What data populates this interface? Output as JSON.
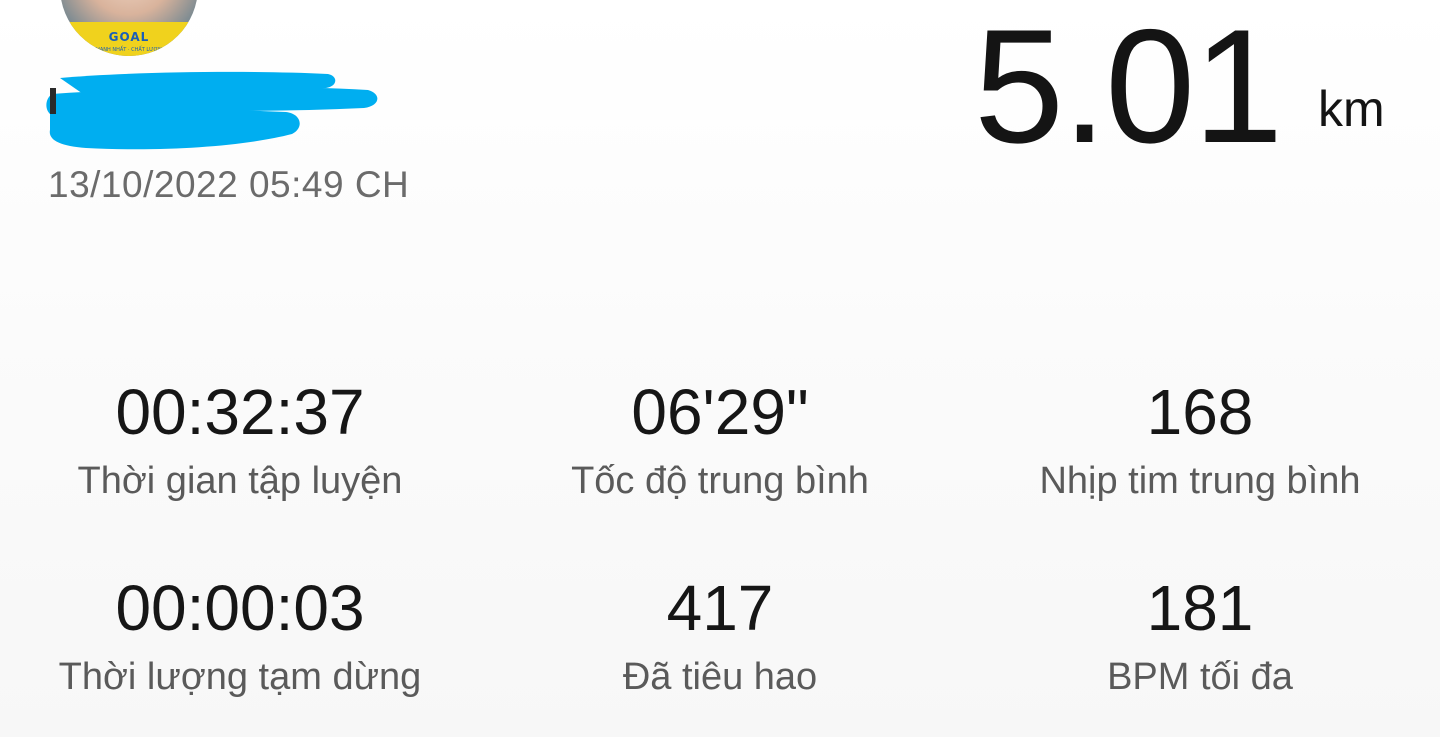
{
  "workout": {
    "avatar": {
      "jersey_text": "GOAL",
      "jersey_sub": "NHANH NHẤT · CHẤT LƯỢNG"
    },
    "date": "13/10/2022 05:49 CH",
    "distance": {
      "value": "5.01",
      "unit": "km"
    },
    "stats": [
      {
        "value": "00:32:37",
        "label": "Thời gian tập luyện"
      },
      {
        "value": "06'29\"",
        "label": "Tốc độ trung bình"
      },
      {
        "value": "168",
        "label": "Nhịp tim trung bình"
      },
      {
        "value": "00:00:03",
        "label": "Thời lượng tạm dừng"
      },
      {
        "value": "417",
        "label": "Đã tiêu hao"
      },
      {
        "value": "181",
        "label": "BPM tối đa"
      }
    ],
    "colors": {
      "redaction": "#00aef0",
      "value_text": "#161616",
      "label_text": "#5a5a5a"
    }
  }
}
